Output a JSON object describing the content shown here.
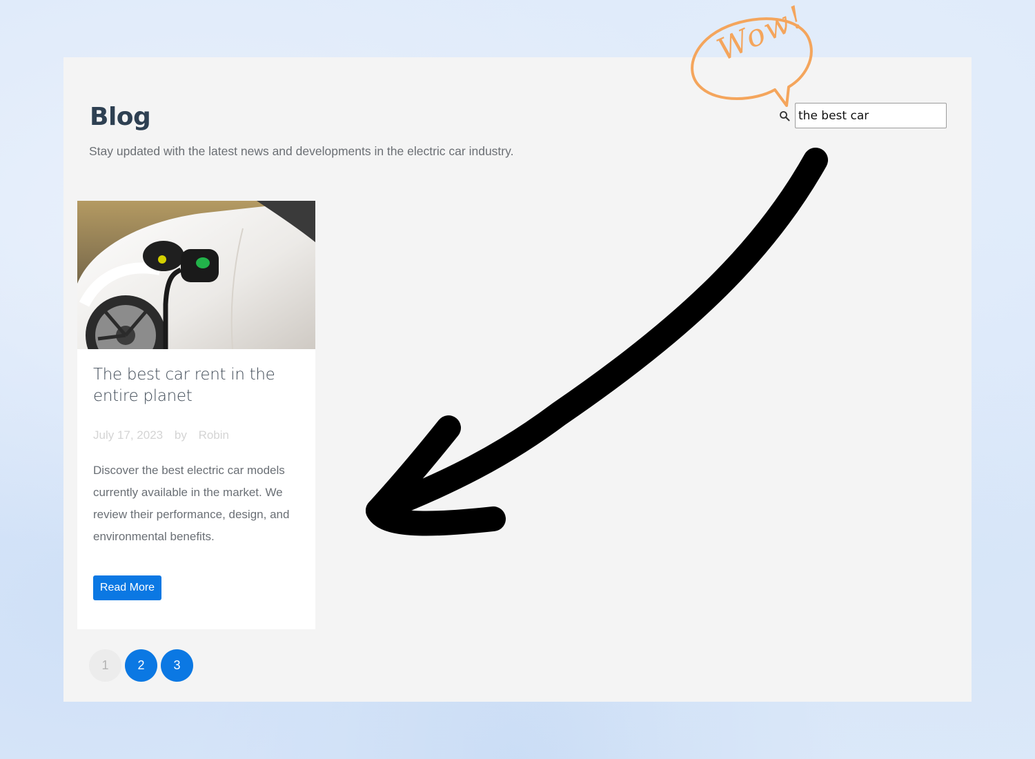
{
  "blog": {
    "title": "Blog",
    "subtitle": "Stay updated with the latest news and developments in the electric car industry."
  },
  "search": {
    "value": "the best car",
    "icon": "search-icon"
  },
  "post": {
    "image": "electric-car-charging-photo",
    "title": "The best car rent in the entire planet",
    "date": "July 17, 2023",
    "by_label": "by",
    "author": "Robin",
    "excerpt": "Discover the best electric car models currently available in the market. We review their performance, design, and environmental benefits.",
    "read_more_label": "Read More"
  },
  "pagination": {
    "pages": [
      "1",
      "2",
      "3"
    ],
    "current": "1"
  },
  "annotation": {
    "bubble_text": "Wow!",
    "arrow": "hand-drawn-arrow"
  },
  "colors": {
    "accent": "#0b78e3",
    "title": "#2e4052",
    "panel": "#f4f4f4",
    "bubble": "#f4a55c",
    "arrow": "#000000"
  }
}
